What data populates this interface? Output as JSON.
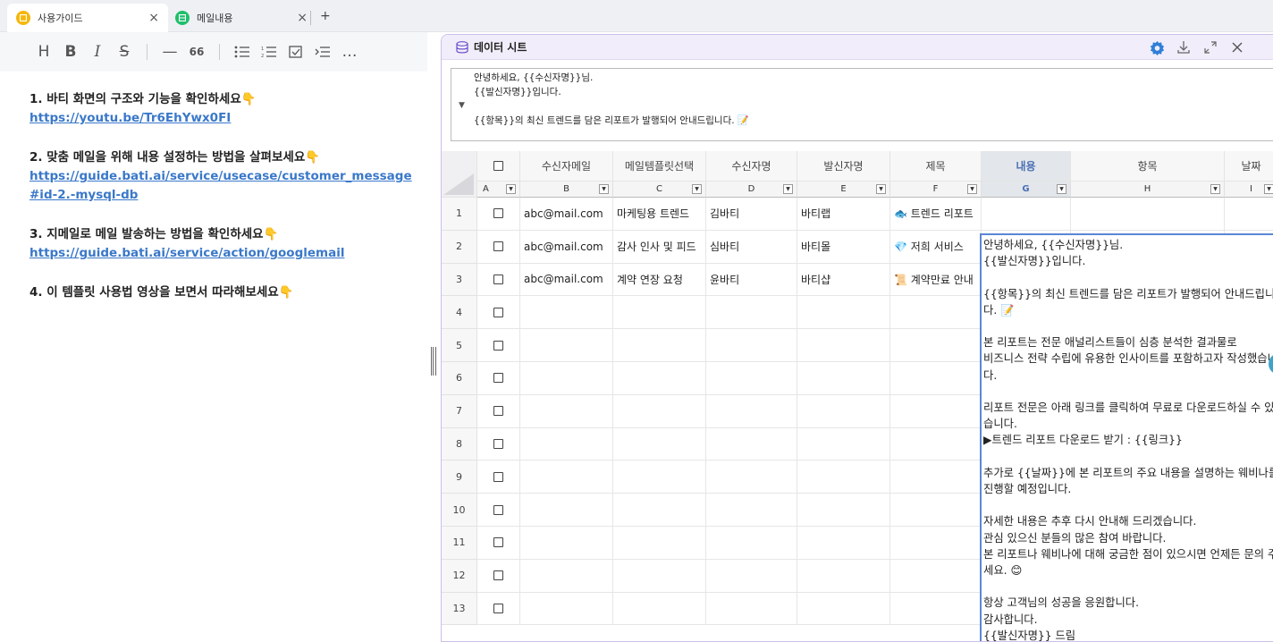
{
  "tabs": [
    {
      "label": "사용가이드",
      "icon": "guide-icon",
      "color": "#f5b70d"
    },
    {
      "label": "메일내용",
      "icon": "sheet-icon",
      "color": "#1fbf6b"
    }
  ],
  "tab_close": "×",
  "new_tab": "+",
  "toolbar": [
    "H",
    "B",
    "I",
    "S",
    "—",
    "66",
    "bulleted-list",
    "numbered-list",
    "checklist",
    "indent",
    "…"
  ],
  "guide": [
    {
      "title": "1. 바티 화면의 구조와 기능을 확인하세요👇",
      "link": "https://youtu.be/Tr6EhYwx0FI"
    },
    {
      "title": "2. 맞춤 메일을 위해 내용 설정하는 방법을 살펴보세요👇",
      "link": "https://guide.bati.ai/service/usecase/customer_message#id-2.-mysql-db"
    },
    {
      "title": "3. 지메일로 메일 발송하는 방법을 확인하세요👇",
      "link": "https://guide.bati.ai/service/action/googlemail"
    },
    {
      "title": "4. 이 템플릿 사용법 영상을 보면서 따라해보세요👇",
      "link": ""
    }
  ],
  "sheet": {
    "title": "데이터 시트",
    "formula_lines": [
      "안녕하세요, {{수신자명}}님.",
      "{{발신자명}}입니다.",
      "",
      "{{항목}}의 최신 트렌드를 담은 리포트가 발행되어 안내드립니다. 📝"
    ],
    "columns": [
      {
        "header": "",
        "letter": "A"
      },
      {
        "header": "수신자메일",
        "letter": "B"
      },
      {
        "header": "메일템플릿선택",
        "letter": "C"
      },
      {
        "header": "수신자명",
        "letter": "D"
      },
      {
        "header": "발신자명",
        "letter": "E"
      },
      {
        "header": "제목",
        "letter": "F"
      },
      {
        "header": "내용",
        "letter": "G"
      },
      {
        "header": "항목",
        "letter": "H"
      },
      {
        "header": "날짜",
        "letter": "I"
      }
    ],
    "rows": [
      {
        "num": "1",
        "email": "abc@mail.com",
        "template": "마케팅용 트렌드",
        "recipient": "김바티",
        "sender": "바티랩",
        "subject": "🐟 트렌드 리포트"
      },
      {
        "num": "2",
        "email": "abc@mail.com",
        "template": "감사 인사 및 피드",
        "recipient": "심바티",
        "sender": "바티몰",
        "subject": "💎 저희 서비스"
      },
      {
        "num": "3",
        "email": "abc@mail.com",
        "template": "계약 연장 요청",
        "recipient": "윤바티",
        "sender": "바티샵",
        "subject": "📜 계약만료 안내"
      },
      {
        "num": "4"
      },
      {
        "num": "5"
      },
      {
        "num": "6"
      },
      {
        "num": "7"
      },
      {
        "num": "8"
      },
      {
        "num": "9"
      },
      {
        "num": "10"
      },
      {
        "num": "11"
      },
      {
        "num": "12"
      },
      {
        "num": "13"
      }
    ],
    "editor_text": "안녕하세요, {{수신자명}}님.\n{{발신자명}}입니다.\n\n{{항목}}의 최신 트렌드를 담은 리포트가 발행되어 안내드립니다. 📝\n\n본 리포트는 전문 애널리스트들이 심층 분석한 결과물로\n비즈니스 전략 수립에 유용한 인사이트를 포함하고자 작성했습니다.\n\n리포트 전문은 아래 링크를 클릭하여 무료로 다운로드하실 수 있습니다.\n▶트렌드 리포트 다운로드 받기 : {{링크}}\n\n추가로 {{날짜}}에 본 리포트의 주요 내용을 설명하는 웨비나를 진행할 예정입니다.\n\n자세한 내용은 추후 다시 안내해 드리겠습니다.\n관심 있으신 분들의 많은 참여 바랍니다.\n본 리포트나 웨비나에 대해 궁금한 점이 있으시면 언제든 문의 주세요. 😊\n\n항상 고객님의 성공을 응원합니다.\n감사합니다.\n{{발신자명}} 드림"
  },
  "colors": {
    "accent": "#4a6fb5",
    "sheet_header": "#f1edfa",
    "link": "#3a78c9",
    "editor_border": "#5b87d6"
  }
}
